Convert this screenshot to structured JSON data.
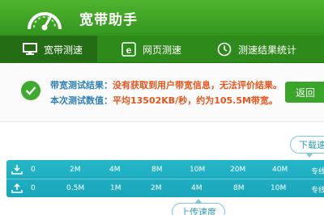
{
  "app": {
    "title": "宽带助手"
  },
  "tabs": [
    {
      "label": "宽带测速",
      "icon": "monitor-icon",
      "active": true
    },
    {
      "label": "网页测速",
      "icon": "browser-icon",
      "active": false
    },
    {
      "label": "测速结果统计",
      "icon": "clock-icon",
      "active": false
    }
  ],
  "result": {
    "line1_label": "带宽测试结果：",
    "line1_value": "没有获取到用户带宽信息，无法评价结果。",
    "line2_label": "本次测试数值：",
    "line2_value": "平均13502KB/秒，约为105.5M带宽。",
    "back_label": "返回",
    "status_icon": "check-icon"
  },
  "speed_scale": {
    "download_tag": "下载速",
    "upload_tag": "上传速度",
    "download_ticks": [
      "0",
      "2M",
      "4M",
      "8M",
      "10M",
      "20M",
      "40M",
      "专线"
    ],
    "upload_ticks": [
      "0",
      "0.5M",
      "1M",
      "2M",
      "4M",
      "8M",
      "10M",
      "专线"
    ]
  },
  "colors": {
    "header": "#3aa52a",
    "accent_orange": "#e8541a",
    "accent_blue": "#2e7fb6",
    "scale_bar": "#1fb0c3"
  }
}
